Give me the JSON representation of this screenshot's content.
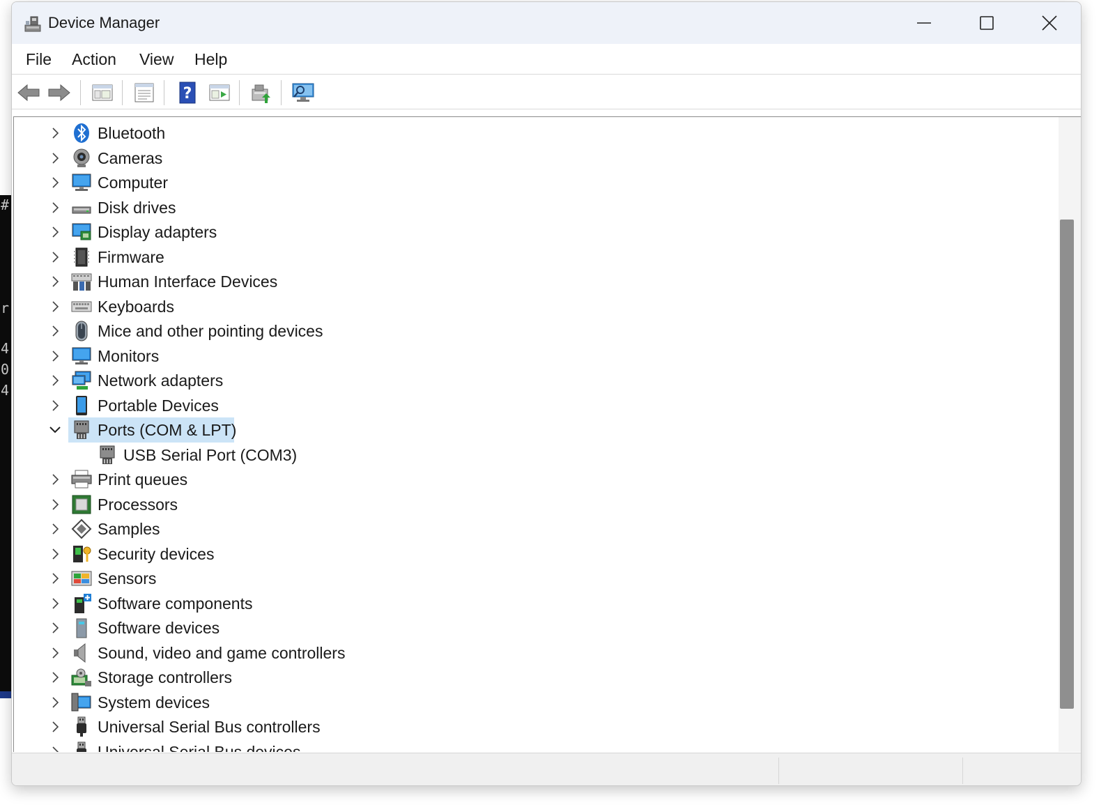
{
  "window": {
    "title": "Device Manager"
  },
  "menu": [
    {
      "label": "File"
    },
    {
      "label": "Action"
    },
    {
      "label": "View"
    },
    {
      "label": "Help"
    }
  ],
  "toolbar": [
    {
      "name": "back-button",
      "icon": "arrow-left-icon"
    },
    {
      "name": "forward-button",
      "icon": "arrow-right-icon"
    },
    {
      "name": "show-hide-console-tree-button",
      "icon": "console-tree-icon"
    },
    {
      "name": "properties-button",
      "icon": "properties-icon"
    },
    {
      "name": "help-button",
      "icon": "help-icon"
    },
    {
      "name": "show-action-pane-button",
      "icon": "action-pane-icon"
    },
    {
      "name": "update-driver-button",
      "icon": "update-driver-icon"
    },
    {
      "name": "scan-hardware-button",
      "icon": "scan-hardware-icon"
    }
  ],
  "tree": [
    {
      "label": "Bluetooth",
      "icon": "bluetooth-icon",
      "expanded": false,
      "level": 0
    },
    {
      "label": "Cameras",
      "icon": "camera-icon",
      "expanded": false,
      "level": 0
    },
    {
      "label": "Computer",
      "icon": "computer-icon",
      "expanded": false,
      "level": 0
    },
    {
      "label": "Disk drives",
      "icon": "disk-drive-icon",
      "expanded": false,
      "level": 0
    },
    {
      "label": "Display adapters",
      "icon": "display-adapter-icon",
      "expanded": false,
      "level": 0
    },
    {
      "label": "Firmware",
      "icon": "firmware-icon",
      "expanded": false,
      "level": 0
    },
    {
      "label": "Human Interface Devices",
      "icon": "hid-icon",
      "expanded": false,
      "level": 0
    },
    {
      "label": "Keyboards",
      "icon": "keyboard-icon",
      "expanded": false,
      "level": 0
    },
    {
      "label": "Mice and other pointing devices",
      "icon": "mouse-icon",
      "expanded": false,
      "level": 0
    },
    {
      "label": "Monitors",
      "icon": "monitor-icon",
      "expanded": false,
      "level": 0
    },
    {
      "label": "Network adapters",
      "icon": "network-adapter-icon",
      "expanded": false,
      "level": 0
    },
    {
      "label": "Portable Devices",
      "icon": "portable-device-icon",
      "expanded": false,
      "level": 0
    },
    {
      "label": "Ports (COM & LPT)",
      "icon": "port-icon",
      "expanded": true,
      "level": 0,
      "selected": true
    },
    {
      "label": "USB Serial Port (COM3)",
      "icon": "port-icon",
      "level": 1
    },
    {
      "label": "Print queues",
      "icon": "printer-icon",
      "expanded": false,
      "level": 0
    },
    {
      "label": "Processors",
      "icon": "processor-icon",
      "expanded": false,
      "level": 0
    },
    {
      "label": "Samples",
      "icon": "samples-icon",
      "expanded": false,
      "level": 0
    },
    {
      "label": "Security devices",
      "icon": "security-device-icon",
      "expanded": false,
      "level": 0
    },
    {
      "label": "Sensors",
      "icon": "sensor-icon",
      "expanded": false,
      "level": 0
    },
    {
      "label": "Software components",
      "icon": "software-component-icon",
      "expanded": false,
      "level": 0
    },
    {
      "label": "Software devices",
      "icon": "software-device-icon",
      "expanded": false,
      "level": 0
    },
    {
      "label": "Sound, video and game controllers",
      "icon": "speaker-icon",
      "expanded": false,
      "level": 0
    },
    {
      "label": "Storage controllers",
      "icon": "storage-controller-icon",
      "expanded": false,
      "level": 0
    },
    {
      "label": "System devices",
      "icon": "system-device-icon",
      "expanded": false,
      "level": 0
    },
    {
      "label": "Universal Serial Bus controllers",
      "icon": "usb-icon",
      "expanded": false,
      "level": 0
    },
    {
      "label": "Universal Serial Bus devices",
      "icon": "usb-icon",
      "expanded": false,
      "level": 0
    }
  ],
  "background_text": [
    "#",
    "r",
    "4",
    "0",
    "4"
  ],
  "colors": {
    "titlebar": "#eef2f9",
    "selection": "#cce4f7",
    "scroll_thumb": "#8f8f8f"
  }
}
